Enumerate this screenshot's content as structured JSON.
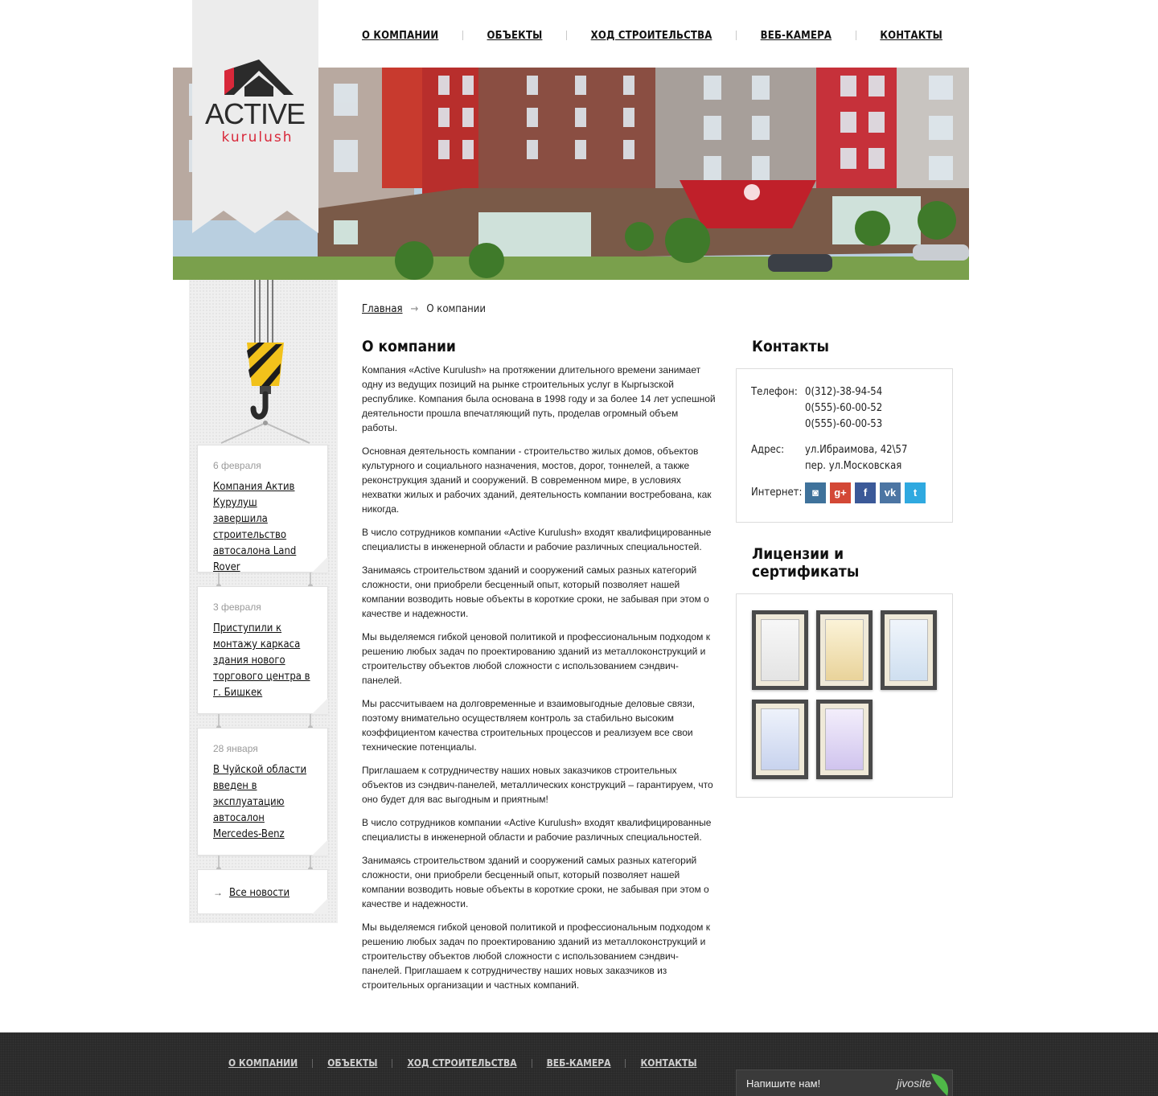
{
  "nav": {
    "items": [
      "О компании",
      "Объекты",
      "Ход строительства",
      "Веб-камера",
      "Контакты"
    ]
  },
  "logo": {
    "title": "ACTIVE",
    "subtitle": "kurulush"
  },
  "breadcrumb": {
    "home": "Главная",
    "current": "О компании"
  },
  "news": [
    {
      "date": "6 февраля",
      "title": "Компания Актив Курулуш завершила строительство автосалона Land Rover"
    },
    {
      "date": "3 февраля",
      "title": "Приступили к монтажу каркаса здания нового торгового центра в г. Бишкек"
    },
    {
      "date": "28 января",
      "title": "В Чуйской области введен в эксплуатацию автосалон Mercedes-Benz"
    }
  ],
  "all_news": "Все новости",
  "main": {
    "title": "О компании",
    "paragraphs": [
      "Компания «Active Kurulush» на протяжении длительного времени занимает одну из ведущих позиций на рынке строительных услуг в Кыргызской республике. Компания была основана в 1998 году и за более 14 лет успешной деятельности прошла впечатляющий путь, проделав огромный объем работы.",
      "Основная деятельность компании - строительство жилых домов, объектов культурного и социального назначения, мостов, дорог, тоннелей, а также реконструкция зданий и сооружений. В современном мире, в условиях нехватки жилых и рабочих зданий, деятельность компании востребована, как никогда.",
      "В число сотрудников компании «Active Kurulush» входят квалифицированные специалисты в инженерной области и рабочие различных специальностей.",
      "Занимаясь строительством зданий и сооружений самых разных категорий сложности, они приобрели бесценный опыт, который позволяет нашей компании возводить новые объекты в короткие сроки, не забывая при этом о качестве и надежности.",
      "Мы выделяемся гибкой ценовой политикой и профессиональным подходом к решению любых задач по проектированию зданий из металлоконструкций и строительству объектов любой сложности с использованием сэндвич-панелей.",
      "Мы рассчитываем на долговременные и взаимовыгодные деловые связи, поэтому внимательно осуществляем контроль за стабильно высоким коэффициентом качества строительных процессов и реализуем все свои технические потенциалы.",
      "Приглашаем к сотрудничеству наших новых заказчиков строительных объектов из сэндвич-панелей, металлических конструкций – гарантируем, что оно будет для вас выгодным и приятным!",
      "В число сотрудников компании «Active Kurulush» входят квалифицированные специалисты в инженерной области и рабочие различных специальностей.",
      "Занимаясь строительством зданий и сооружений самых разных категорий сложности, они приобрели бесценный опыт, который позволяет нашей компании возводить новые объекты в короткие сроки, не забывая при этом о качестве и надежности.",
      "Мы выделяемся гибкой ценовой политикой и профессиональным подходом к решению любых задач по проектированию зданий из металлоконструкций и строительству объектов любой сложности с использованием сэндвич-панелей. Приглашаем к сотрудничеству наших новых заказчиков из строительных организации и частных компаний."
    ]
  },
  "contacts": {
    "title": "Контакты",
    "phone_label": "Телефон:",
    "phones": [
      "0(312)-38-94-54",
      "0(555)-60-00-52",
      "0(555)-60-00-53"
    ],
    "address_label": "Адрес:",
    "address_lines": [
      "ул.Ибраимова, 42\\57",
      "пер. ул.Московская"
    ],
    "internet_label": "Интернет:",
    "social": [
      {
        "icon": "instagram-icon",
        "color": "#3f729b",
        "glyph": "◙"
      },
      {
        "icon": "google-plus-icon",
        "color": "#d34836",
        "glyph": "g+"
      },
      {
        "icon": "facebook-icon",
        "color": "#3b5998",
        "glyph": "f"
      },
      {
        "icon": "vk-icon",
        "color": "#4c75a3",
        "glyph": "vk"
      },
      {
        "icon": "twitter-icon",
        "color": "#2fa9e0",
        "glyph": "t"
      }
    ]
  },
  "licenses": {
    "title": "Лицензии и сертификаты",
    "count": 5
  },
  "footer": {
    "items": [
      "О компании",
      "Объекты",
      "Ход строительства",
      "Веб-камера",
      "Контакты"
    ]
  },
  "chat": {
    "message": "Напишите нам!",
    "brand": "jivosite"
  },
  "colors": {
    "accent_red": "#d8283a",
    "dark": "#2a2a2a"
  }
}
